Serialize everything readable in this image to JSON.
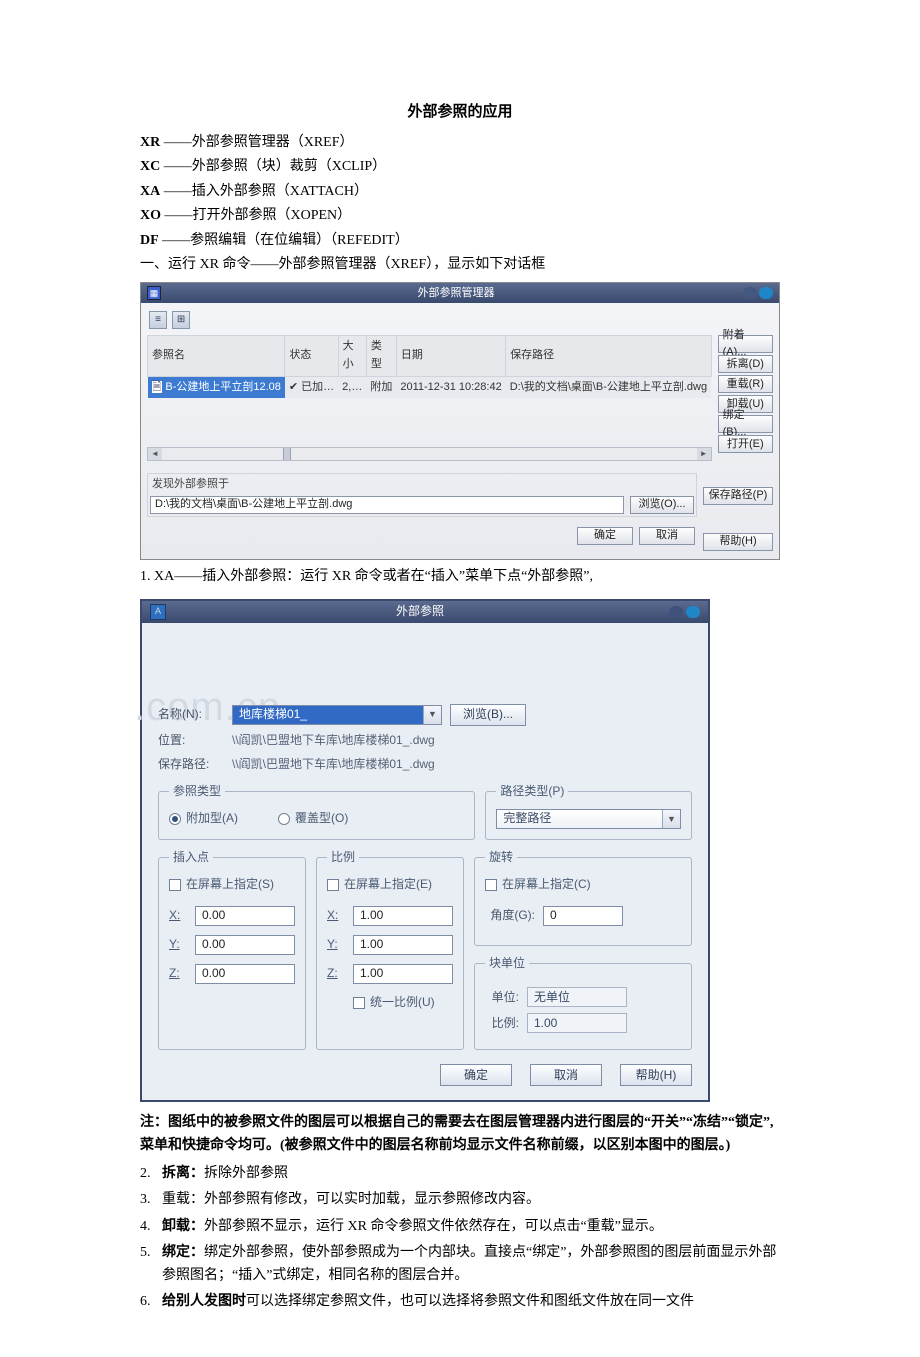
{
  "title": "外部参照的应用",
  "cmds": [
    {
      "abbr": "XR",
      "dash": " ——",
      "desc": "外部参照管理器（XREF）"
    },
    {
      "abbr": "XC",
      "dash": " ——",
      "desc": "外部参照（块）裁剪（XCLIP）"
    },
    {
      "abbr": "XA",
      "dash": " ——",
      "desc": "插入外部参照（XATTACH）"
    },
    {
      "abbr": "XO",
      "dash": " ——",
      "desc": "打开外部参照（XOPEN）"
    },
    {
      "abbr": "DF",
      "dash": " ——",
      "desc": "参照编辑（在位编辑）（REFEDIT）"
    }
  ],
  "section1_intro": "一、运行 XR 命令——外部参照管理器（XREF），显示如下对话框",
  "mgr": {
    "title": "外部参照管理器",
    "cols": {
      "name": "参照名",
      "status": "状态",
      "size": "大小",
      "type": "类型",
      "date": "日期",
      "path": "保存路径"
    },
    "row": {
      "name": "B-公建地上平立剖12.08",
      "status": "✔ 已加…",
      "size": "2,…",
      "type": "附加",
      "date": "2011-12-31 10:28:42",
      "path": "D:\\我的文档\\桌面\\B-公建地上平立剖.dwg"
    },
    "buttons": {
      "attach": "附着(A)...",
      "detach": "拆离(D)",
      "reload": "重载(R)",
      "unload": "卸载(U)",
      "bind": "绑定(B)...",
      "open": "打开(E)"
    },
    "found_label": "发现外部参照于",
    "found_path": "D:\\我的文档\\桌面\\B-公建地上平立剖.dwg",
    "browse": "浏览(O)...",
    "savepath": "保存路径(P)",
    "ok": "确定",
    "cancel": "取消",
    "help": "帮助(H)"
  },
  "item1": "1.   XA——插入外部参照：运行 XR 命令或者在“插入”菜单下点“外部参照”,",
  "attach": {
    "title": "外部参照",
    "name_label": "名称(N):",
    "name_value": "地库楼梯01_",
    "browse": "浏览(B)...",
    "loc_label": "位置:",
    "loc_value": "\\\\阎凯\\巴盟地下车库\\地库楼梯01_.dwg",
    "sp_label": "保存路径:",
    "sp_value": "\\\\阎凯\\巴盟地下车库\\地库楼梯01_.dwg",
    "reftype_legend": "参照类型",
    "reftype_attach": "附加型(A)",
    "reftype_overlay": "覆盖型(O)",
    "pathtype_legend": "路径类型(P)",
    "pathtype_value": "完整路径",
    "insert_legend": "插入点",
    "onscreen_s": "在屏幕上指定(S)",
    "x_label": "X:",
    "y_label": "Y:",
    "z_label": "Z:",
    "x": "0.00",
    "y": "0.00",
    "z": "0.00",
    "scale_legend": "比例",
    "onscreen_e": "在屏幕上指定(E)",
    "sx_label": "X:",
    "sy_label": "Y:",
    "sz_label": "Z:",
    "sx": "1.00",
    "sy": "1.00",
    "sz": "1.00",
    "uniform": "统一比例(U)",
    "rotate_legend": "旋转",
    "onscreen_c": "在屏幕上指定(C)",
    "angle_label": "角度(G):",
    "angle": "0",
    "block_legend": "块单位",
    "unit_label": "单位:",
    "unit_value": "无单位",
    "ratio_label": "比例:",
    "ratio_value": "1.00",
    "ok": "确定",
    "cancel": "取消",
    "help": "帮助(H)"
  },
  "note_line1": "注：图纸中的被参照文件的图层可以根据自己的需要去在图层管理器内进行图层的“开关”“冻结”“锁定”,菜单和快捷命令均可。(被参照文件中的图层名称前均显示文件名称前缀，以区别本图中的图层。)",
  "list": [
    {
      "n": "2.",
      "head": "拆离：",
      "body": "拆除外部参照"
    },
    {
      "n": "3.",
      "head": "",
      "body": "重载：外部参照有修改，可以实时加载，显示参照修改内容。"
    },
    {
      "n": "4.",
      "head": "卸载：",
      "body": "外部参照不显示，运行 XR 命令参照文件依然存在，可以点击“重载”显示。"
    },
    {
      "n": "5.",
      "head": "绑定：",
      "body": "绑定外部参照，使外部参照成为一个内部块。直接点“绑定”，外部参照图的图层前面显示外部参照图名；“插入”式绑定，相同名称的图层合并。"
    },
    {
      "n": "6.",
      "head": "给别人发图时",
      "body": "可以选择绑定参照文件，也可以选择将参照文件和图纸文件放在同一文件"
    }
  ],
  "watermark": ".com.cn"
}
